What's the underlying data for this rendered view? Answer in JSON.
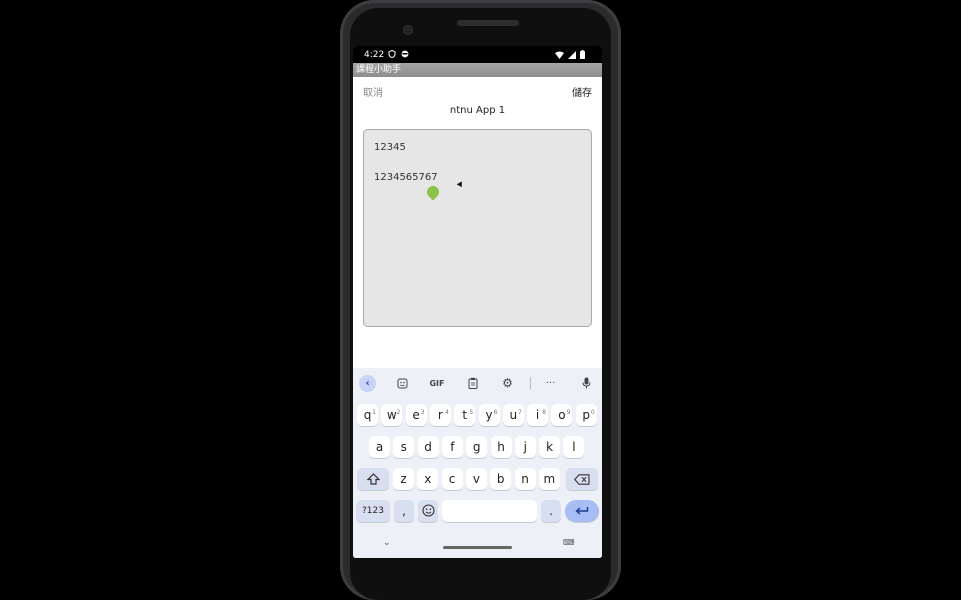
{
  "status": {
    "time": "4:22"
  },
  "app": {
    "title": "課程小助手"
  },
  "actions": {
    "cancel": "取消",
    "save": "儲存"
  },
  "subtitle": "ntnu App 1",
  "editor": {
    "lines": [
      "12345",
      "1234565767"
    ]
  },
  "keyboard": {
    "toolbar": {
      "gif": "GIF",
      "more": "···"
    },
    "row1": [
      {
        "k": "q",
        "n": "1"
      },
      {
        "k": "w",
        "n": "2"
      },
      {
        "k": "e",
        "n": "3"
      },
      {
        "k": "r",
        "n": "4"
      },
      {
        "k": "t",
        "n": "5"
      },
      {
        "k": "y",
        "n": "6"
      },
      {
        "k": "u",
        "n": "7"
      },
      {
        "k": "i",
        "n": "8"
      },
      {
        "k": "o",
        "n": "9"
      },
      {
        "k": "p",
        "n": "0"
      }
    ],
    "row2": [
      "a",
      "s",
      "d",
      "f",
      "g",
      "h",
      "j",
      "k",
      "l"
    ],
    "row3": [
      "z",
      "x",
      "c",
      "v",
      "b",
      "n",
      "m"
    ],
    "symbols": "?123",
    "comma": ",",
    "period": "."
  }
}
